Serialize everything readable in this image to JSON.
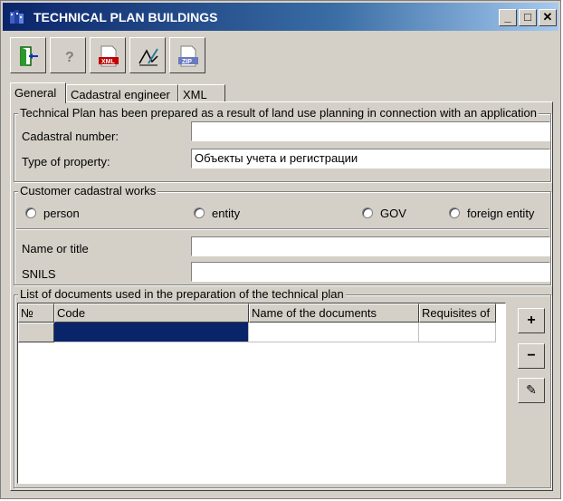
{
  "window": {
    "title": "TECHNICAL PLAN BUILDINGS"
  },
  "tabs": [
    {
      "label": "General",
      "active": true
    },
    {
      "label": "Cadastral engineer",
      "active": false
    },
    {
      "label": "XML",
      "active": false
    }
  ],
  "toolbar": {
    "icons": [
      "exit-icon",
      "help-icon",
      "xml-file-icon",
      "sign-icon",
      "zip-file-icon"
    ],
    "xml_badge": "XML",
    "zip_badge": "ZIP"
  },
  "plan_group": {
    "title": "Technical Plan has been prepared as a result of land use planning in connection with an application",
    "cadastral_number_label": "Cadastral number:",
    "cadastral_number_value": "",
    "type_of_property_label": "Type of property:",
    "type_of_property_value": "Объекты учета и регистрации"
  },
  "customer_group": {
    "title": "Customer cadastral works",
    "options": [
      "person",
      "entity",
      "GOV",
      "foreign entity"
    ],
    "name_label": "Name or title",
    "name_value": "",
    "snils_label": "SNILS",
    "snils_value": ""
  },
  "documents_group": {
    "title": "List of documents used in the preparation of the technical plan",
    "columns": [
      "№",
      "Code",
      "Name of the documents",
      "Requisites of"
    ],
    "buttons": {
      "add": "+",
      "remove": "−",
      "edit": "✎"
    }
  },
  "colors": {
    "title_bar": "#0a246a",
    "selection": "#0a246a",
    "face": "#d4d0c8"
  }
}
